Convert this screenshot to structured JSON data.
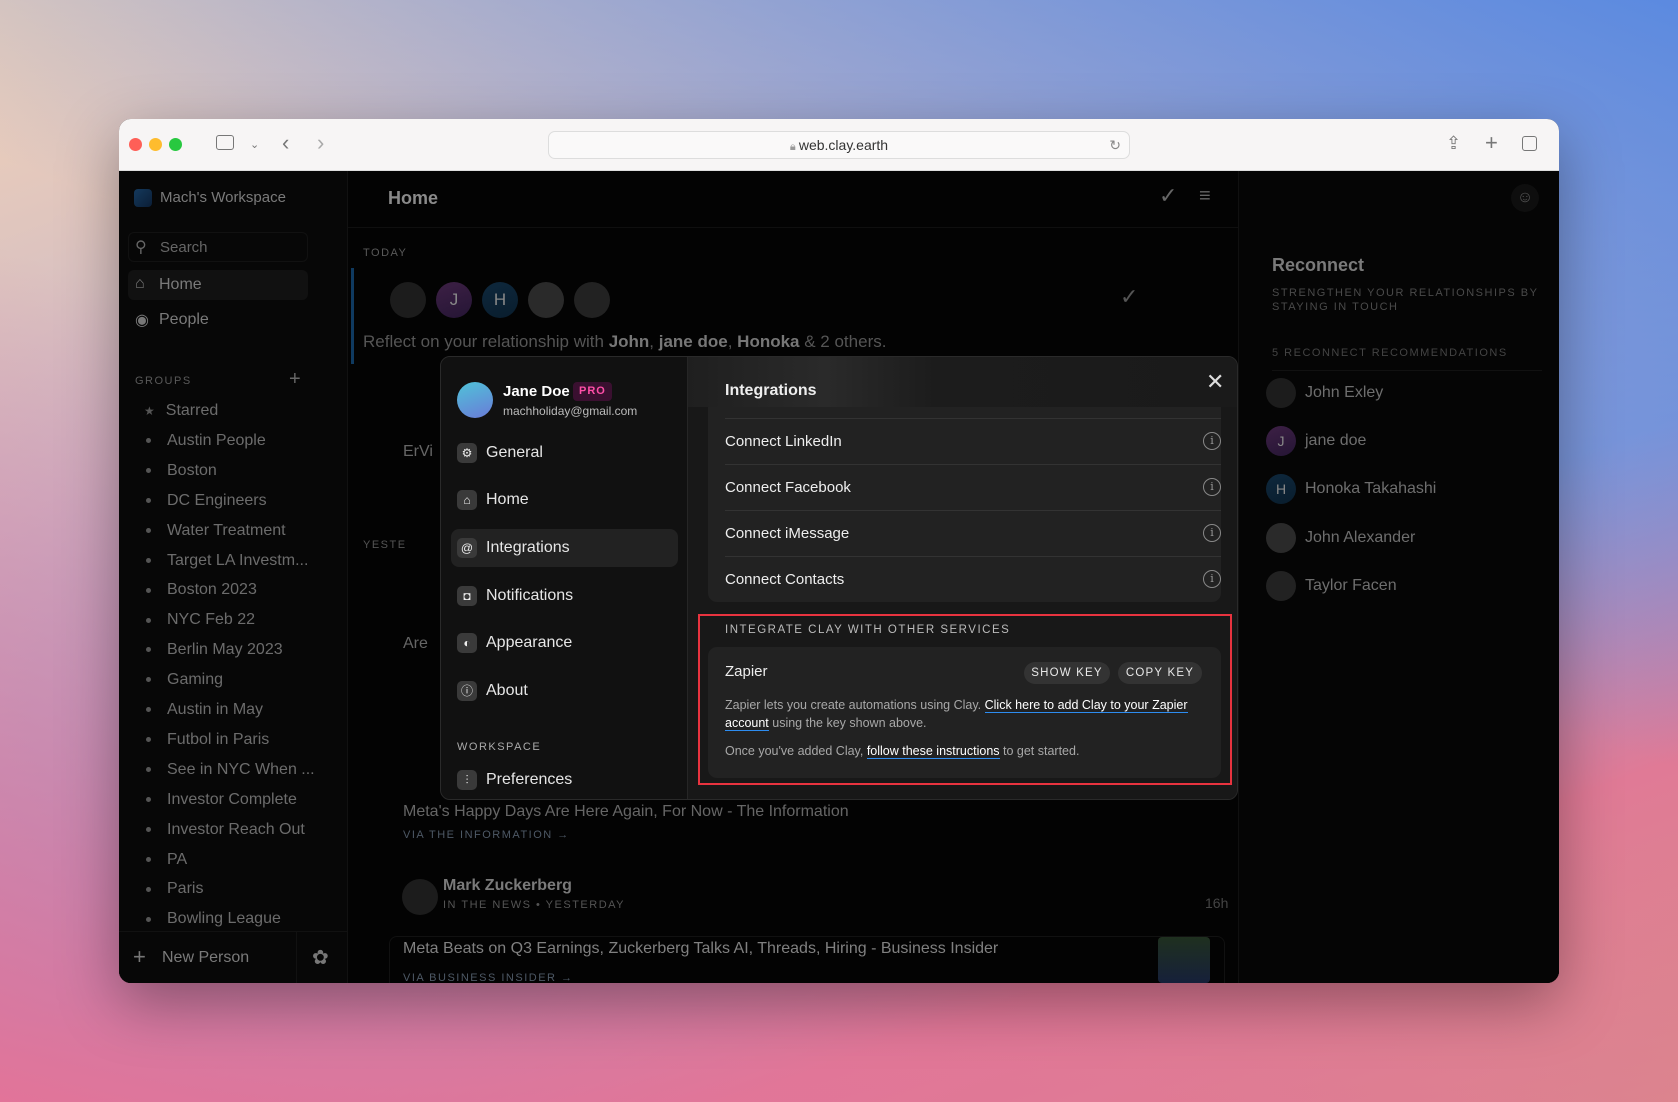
{
  "browser": {
    "url": "web.clay.earth"
  },
  "sidebar": {
    "workspace": "Mach's Workspace",
    "search_placeholder": "Search",
    "nav": [
      {
        "label": "Home"
      },
      {
        "label": "People"
      }
    ],
    "groups_heading": "GROUPS",
    "groups": [
      "Starred",
      "Austin People",
      "Boston",
      "DC Engineers",
      "Water Treatment",
      "Target LA Investm...",
      "Boston 2023",
      "NYC Feb 22",
      "Berlin May 2023",
      "Gaming",
      "Austin in May",
      "Futbol in Paris",
      "See in NYC When ...",
      "Investor Complete",
      "Investor Reach Out",
      "PA",
      "Paris",
      "Bowling League"
    ],
    "new_person": "New Person"
  },
  "main": {
    "title": "Home",
    "today": "TODAY",
    "avatars": [
      {
        "initial": ""
      },
      {
        "initial": "J"
      },
      {
        "initial": "H"
      },
      {
        "initial": ""
      },
      {
        "initial": ""
      }
    ],
    "reflect": {
      "prefix": "Reflect on your relationship with ",
      "n1": "John",
      "n2": "jane doe",
      "n3": "Honoka",
      "suffix": " & 2 others."
    },
    "feed": {
      "item1": "ErVi",
      "yesterday": "YESTE",
      "item2": "Are",
      "item3": "Meta's Happy Days Are Here Again, For Now - The Information",
      "item3_via": "VIA THE INFORMATION →",
      "person": "Mark Zuckerberg",
      "person_meta": "IN THE NEWS • YESTERDAY",
      "time": "16h",
      "item4": "Meta Beats on Q3 Earnings, Zuckerberg Talks AI, Threads, Hiring - Business Insider",
      "item4_via": "VIA BUSINESS INSIDER →"
    }
  },
  "right": {
    "title": "Reconnect",
    "subtitle": "STRENGTHEN YOUR RELATIONSHIPS BY STAYING IN TOUCH",
    "count": "5 RECONNECT RECOMMENDATIONS",
    "people": [
      {
        "name": "John Exley",
        "initial": ""
      },
      {
        "name": "jane doe",
        "initial": "J"
      },
      {
        "name": "Honoka Takahashi",
        "initial": "H"
      },
      {
        "name": "John Alexander",
        "initial": ""
      },
      {
        "name": "Taylor Facen",
        "initial": ""
      }
    ]
  },
  "modal": {
    "user": {
      "name": "Jane Doe",
      "badge": "PRO",
      "email": "machholiday@gmail.com"
    },
    "nav": [
      {
        "label": "General",
        "icon": "gear-icon"
      },
      {
        "label": "Home",
        "icon": "home-icon"
      },
      {
        "label": "Integrations",
        "icon": "at-icon",
        "active": true
      },
      {
        "label": "Notifications",
        "icon": "notification-icon"
      },
      {
        "label": "Appearance",
        "icon": "contrast-icon"
      },
      {
        "label": "About",
        "icon": "info-icon"
      }
    ],
    "workspace_heading": "WORKSPACE",
    "workspace_nav": [
      {
        "label": "Preferences",
        "icon": "sliders-icon"
      }
    ],
    "title": "Integrations",
    "connections": [
      "Connect LinkedIn",
      "Connect Facebook",
      "Connect iMessage",
      "Connect Contacts"
    ],
    "services_heading": "INTEGRATE CLAY WITH OTHER SERVICES",
    "zapier": {
      "name": "Zapier",
      "show_key": "SHOW KEY",
      "copy_key": "COPY KEY",
      "desc_prefix": "Zapier lets you create automations using Clay. ",
      "desc_link": "Click here to add Clay to your Zapier account",
      "desc_suffix": " using the key shown above.",
      "note_prefix": "Once you've added Clay, ",
      "note_link": "follow these instructions",
      "note_suffix": " to get started."
    }
  },
  "colors": {
    "highlight": "#e8333f",
    "link_underline": "#2d8cf0",
    "pro_badge": "#e0409a"
  }
}
